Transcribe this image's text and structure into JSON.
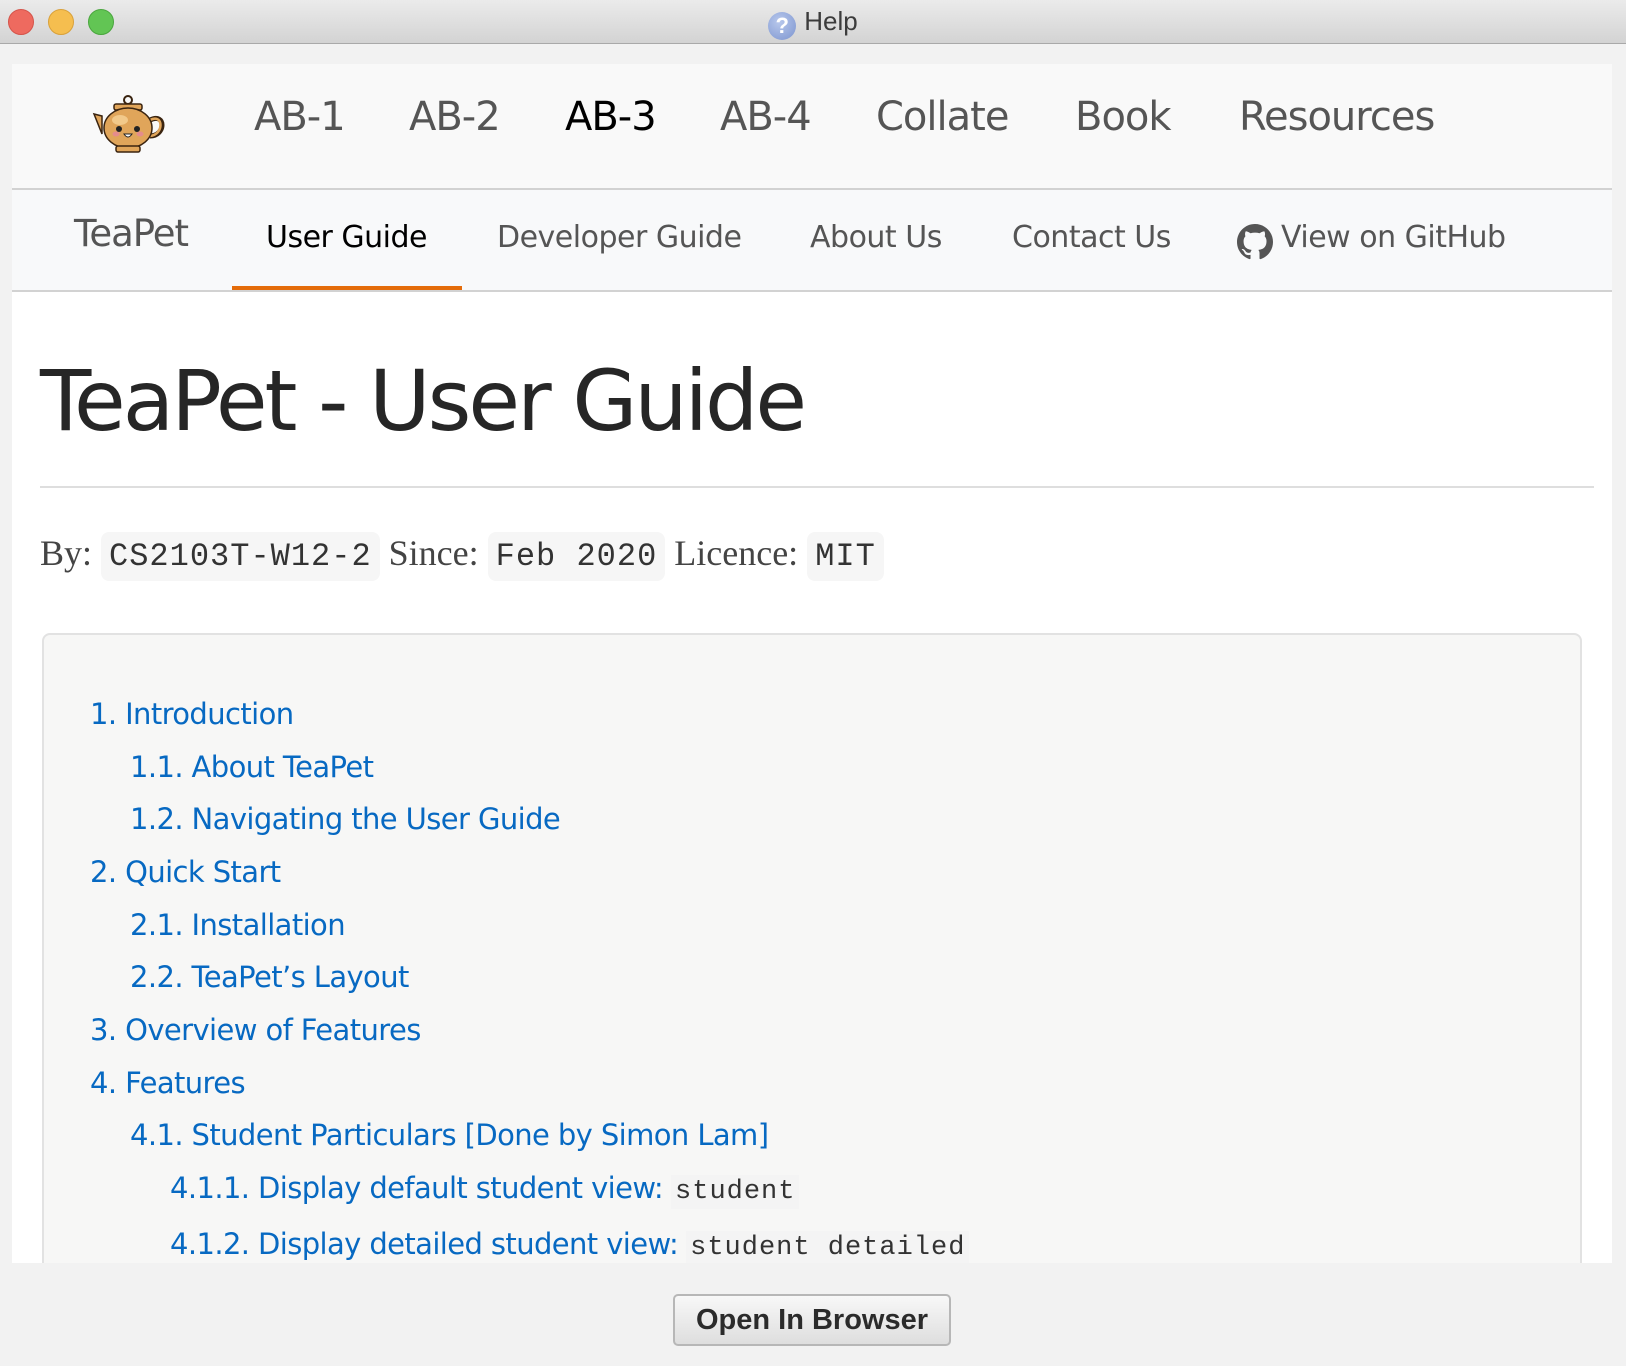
{
  "window": {
    "title": "Help",
    "title_icon": "help-question-icon",
    "controls": [
      "close",
      "minimize",
      "maximize"
    ]
  },
  "topnav": {
    "logo": "teapot-logo",
    "items": [
      {
        "label": "AB-1",
        "active": false
      },
      {
        "label": "AB-2",
        "active": false
      },
      {
        "label": "AB-3",
        "active": true
      },
      {
        "label": "AB-4",
        "active": false
      },
      {
        "label": "Collate",
        "active": false
      },
      {
        "label": "Book",
        "active": false
      },
      {
        "label": "Resources",
        "active": false
      }
    ]
  },
  "subnav": {
    "brand": "TeaPet",
    "items": [
      {
        "label": "User Guide",
        "active": true
      },
      {
        "label": "Developer Guide",
        "active": false
      },
      {
        "label": "About Us",
        "active": false
      },
      {
        "label": "Contact Us",
        "active": false
      },
      {
        "label": "View on GitHub",
        "icon": "github-icon",
        "active": false
      }
    ],
    "accent_color": "#e46c0a"
  },
  "page": {
    "title": "TeaPet - User Guide",
    "meta": {
      "by_label": "By:",
      "by_value": "CS2103T-W12-2",
      "since_label": "Since:",
      "since_value": "Feb 2020",
      "licence_label": "Licence:",
      "licence_value": "MIT"
    },
    "toc": [
      {
        "label": "1. Introduction",
        "level": 1
      },
      {
        "label": "1.1. About TeaPet",
        "level": 2
      },
      {
        "label": "1.2. Navigating the User Guide",
        "level": 2
      },
      {
        "label": "2. Quick Start",
        "level": 1
      },
      {
        "label": "2.1. Installation",
        "level": 2
      },
      {
        "label": "2.2. TeaPet’s Layout",
        "level": 2
      },
      {
        "label": "3. Overview of Features",
        "level": 1
      },
      {
        "label": "4. Features",
        "level": 1
      },
      {
        "label": "4.1. Student Particulars [Done by Simon Lam]",
        "level": 2
      },
      {
        "label": "4.1.1. Display default student view:",
        "code": "student",
        "level": 3
      },
      {
        "label": "4.1.2. Display detailed student view:",
        "code": "student detailed",
        "level": 3
      }
    ],
    "link_color": "#0769c2"
  },
  "footer": {
    "open_in_browser_label": "Open In Browser"
  }
}
